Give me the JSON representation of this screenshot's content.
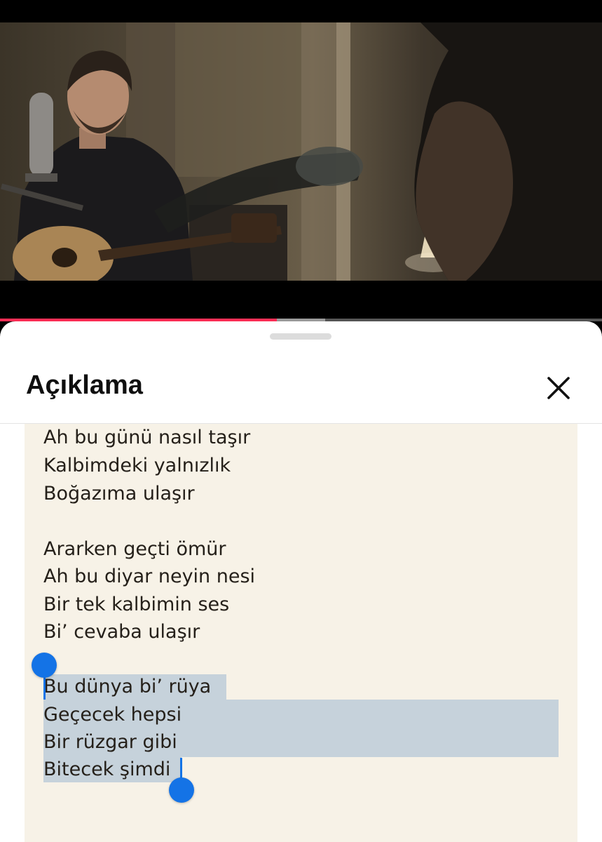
{
  "video": {
    "progress_fraction": 0.46,
    "buffered_fraction": 0.54,
    "progress_color": "#ff2d55"
  },
  "sheet": {
    "title": "Açıklama",
    "close_icon": "close-icon"
  },
  "lyrics": {
    "lines": [
      "Ah bu günü nasıl taşır",
      "Kalbimdeki yalnızlık",
      "Boğazıma ulaşır",
      "",
      "Ararken geçti ömür",
      "Ah bu diyar neyin nesi",
      "Bir tek kalbimin ses",
      "Bi’ cevaba ulaşır",
      "",
      "Bu dünya bi’ rüya",
      "Geçecek hepsi",
      "Bir rüzgar gibi",
      "Bitecek şimdi"
    ],
    "selection_start_line": 9,
    "selection_end_line": 12,
    "selection_color": "#c6d2db",
    "handle_color": "#1473e6",
    "background_color": "#f7f2e7"
  }
}
